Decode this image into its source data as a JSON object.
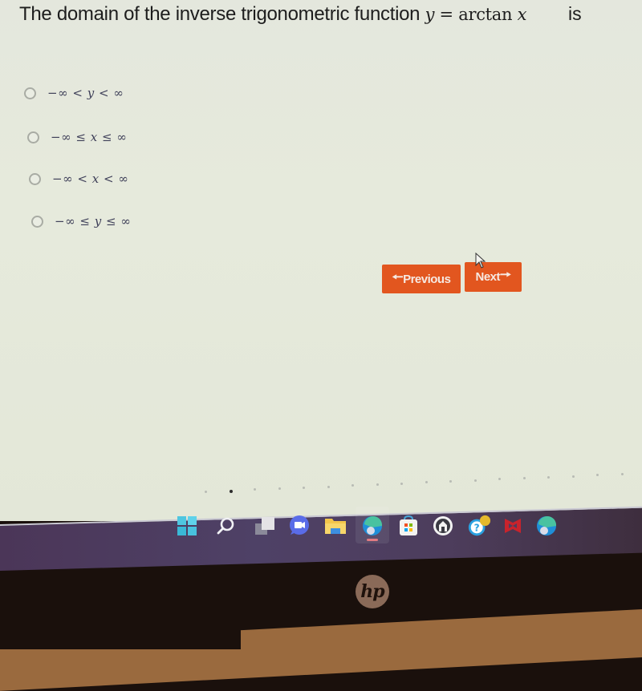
{
  "question": {
    "text": "The domain of the inverse trigonometric function",
    "expression": {
      "lhs": "y",
      "op": "=",
      "fn": "arctan",
      "arg": "x"
    },
    "tail": "is"
  },
  "options": [
    {
      "id": "a",
      "left": "−∞",
      "op1": "<",
      "var": "y",
      "op2": "<",
      "right": "∞",
      "selected": false
    },
    {
      "id": "b",
      "left": "−∞",
      "op1": "≤",
      "var": "x",
      "op2": "≤",
      "right": "∞",
      "selected": false
    },
    {
      "id": "c",
      "left": "−∞",
      "op1": "<",
      "var": "x",
      "op2": "<",
      "right": "∞",
      "selected": false
    },
    {
      "id": "d",
      "left": "−∞",
      "op1": "≤",
      "var": "y",
      "op2": "≤",
      "right": "∞",
      "selected": false
    }
  ],
  "navigation": {
    "previous_label": "Previous",
    "previous_icon": "arrow-left-icon",
    "next_label": "Next",
    "next_icon": "arrow-right-icon",
    "accent_color": "#e2561f"
  },
  "pagination": {
    "total_visible": 18,
    "current_index": 1
  },
  "taskbar": {
    "items": [
      {
        "name": "start",
        "icon": "windows-start-icon"
      },
      {
        "name": "search",
        "icon": "search-icon"
      },
      {
        "name": "task-view",
        "icon": "task-view-icon"
      },
      {
        "name": "meet",
        "icon": "video-chat-icon"
      },
      {
        "name": "file-explorer",
        "icon": "folder-icon"
      },
      {
        "name": "edge",
        "icon": "edge-browser-icon",
        "active": true
      },
      {
        "name": "store",
        "icon": "store-icon"
      },
      {
        "name": "app",
        "icon": "house-app-icon"
      },
      {
        "name": "help",
        "icon": "help-icon"
      },
      {
        "name": "mcafee",
        "icon": "mcafee-icon"
      },
      {
        "name": "edge-profile",
        "icon": "edge-browser-icon"
      }
    ]
  },
  "bezel": {
    "brand": "hp"
  }
}
